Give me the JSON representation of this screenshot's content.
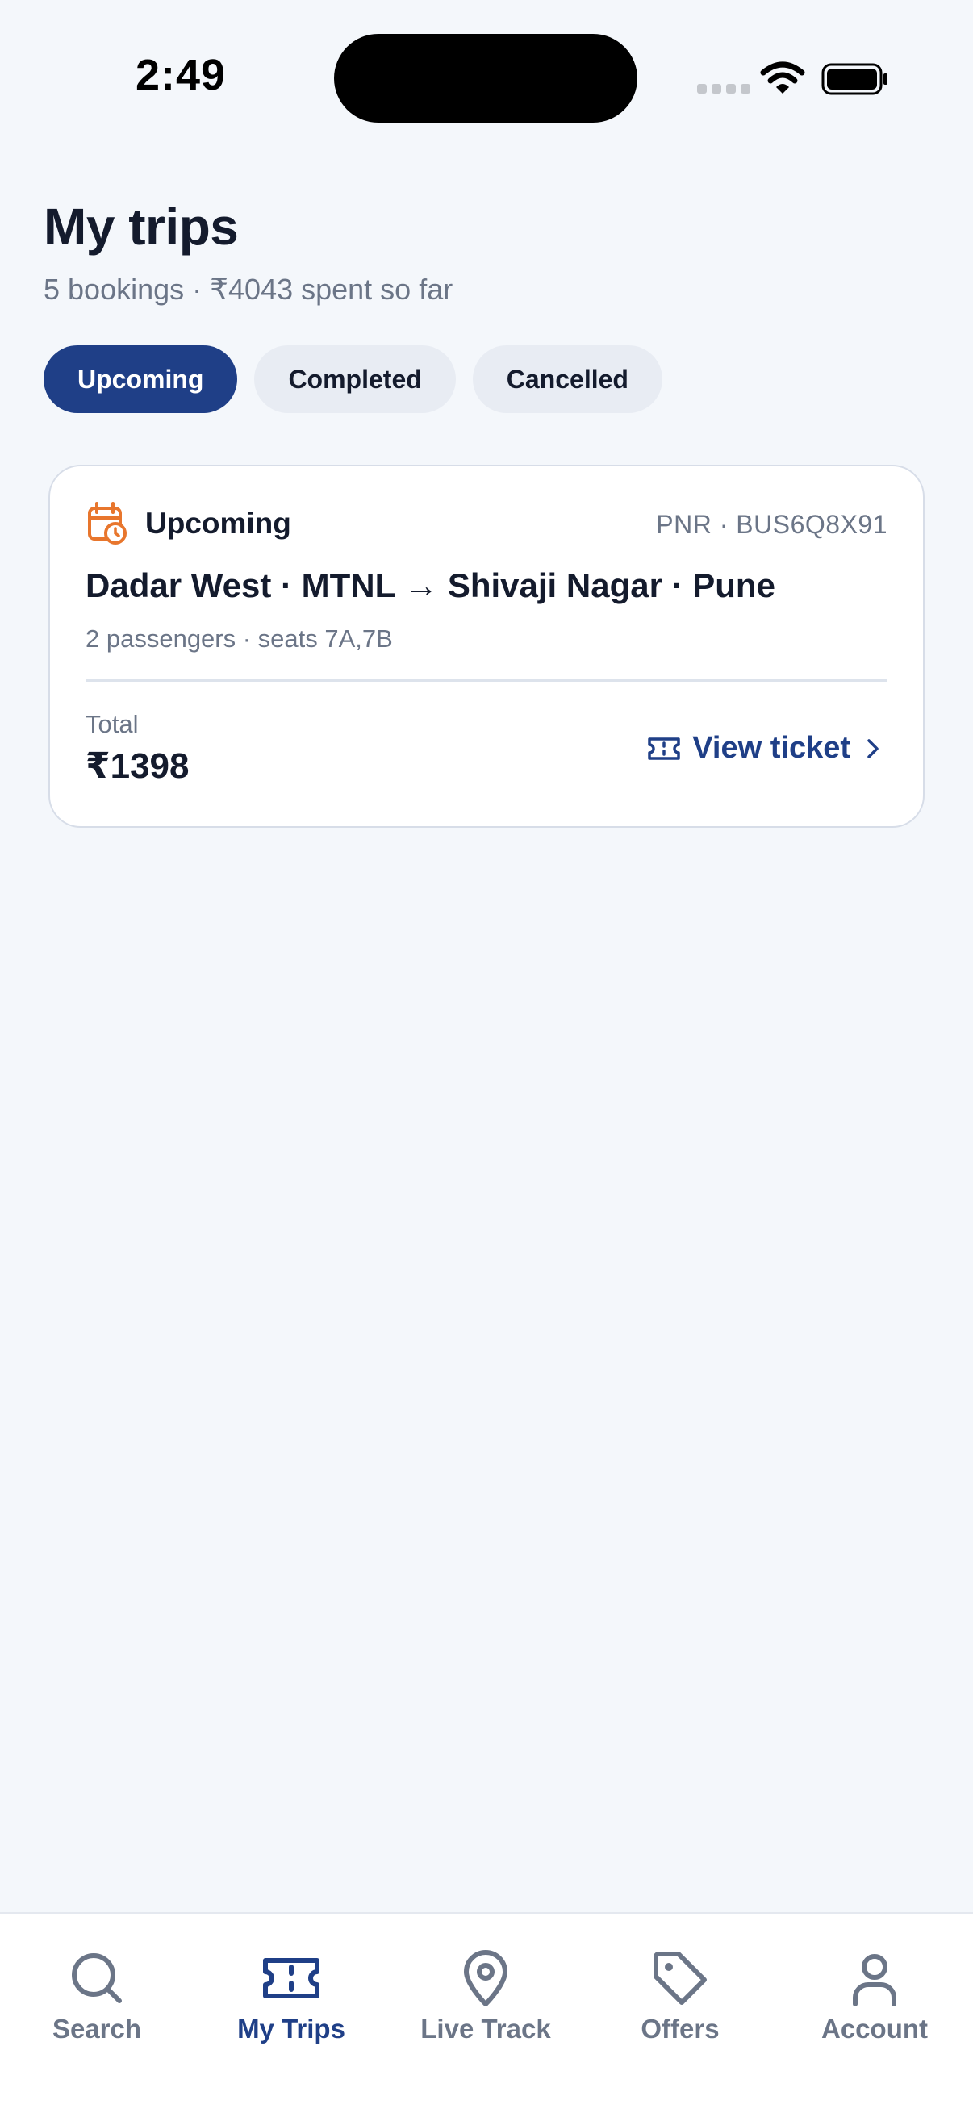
{
  "status_bar": {
    "time": "2:49",
    "icons": [
      "cellular-signal-icon",
      "wifi-icon",
      "battery-icon"
    ]
  },
  "header": {
    "title": "My trips",
    "subtitle": "5 bookings · ₹4043 spent so far"
  },
  "tabs": [
    {
      "label": "Upcoming",
      "active": true
    },
    {
      "label": "Completed",
      "active": false
    },
    {
      "label": "Cancelled",
      "active": false
    }
  ],
  "trip_card": {
    "status_icon": "calendar-clock-icon",
    "status": "Upcoming",
    "pnr": "PNR · BUS6Q8X91",
    "route": "Dadar West · MTNL → Shivaji Nagar · Pune",
    "details": "2 passengers · seats 7A,7B",
    "total_label": "Total",
    "total_value": "₹1398",
    "view_ticket_label": "View ticket",
    "view_ticket_icon": "ticket-icon"
  },
  "bottom_nav": [
    {
      "label": "Search",
      "icon": "search-icon",
      "active": false
    },
    {
      "label": "My Trips",
      "icon": "ticket-icon",
      "active": true
    },
    {
      "label": "Live Track",
      "icon": "map-pin-icon",
      "active": false
    },
    {
      "label": "Offers",
      "icon": "tag-icon",
      "active": false
    },
    {
      "label": "Account",
      "icon": "user-icon",
      "active": false
    }
  ],
  "colors": {
    "primary": "#1f3f87",
    "accent": "#e8762d",
    "background": "#f4f7fb",
    "muted_text": "#6b7587"
  }
}
